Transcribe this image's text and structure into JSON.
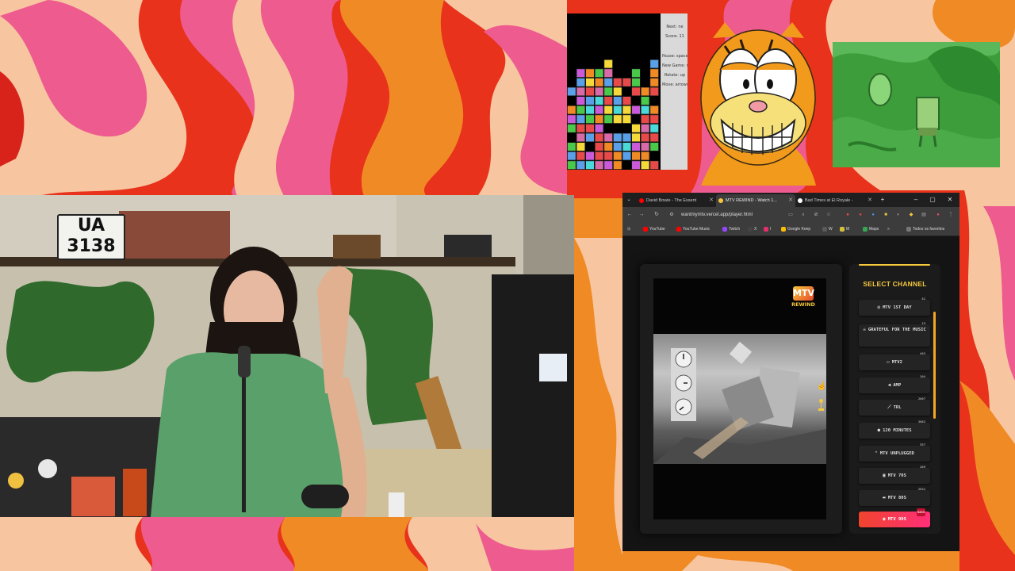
{
  "webcam": {
    "plate": [
      "UA",
      "3138"
    ]
  },
  "tetris": {
    "panel": [
      "Next: ne",
      "Score: 11",
      "Pause: space",
      "New Game: return",
      "Rotate: up",
      "Move: arrows"
    ]
  },
  "browser": {
    "tabs": [
      {
        "label": "David Bowie - The Essent",
        "color": "#ff0000",
        "active": false
      },
      {
        "label": "MTV REWIND - Watch 1...",
        "color": "#f5c73c",
        "active": true
      },
      {
        "label": "Bad Times at El Royale -",
        "color": "#ffffff",
        "active": false
      }
    ],
    "new_tab": "+",
    "window_controls": [
      "–",
      "▢",
      "✕"
    ],
    "nav": {
      "back": "←",
      "forward": "→",
      "reload": "↻"
    },
    "url": "wantmymtv.vercel.app/player.html",
    "bookmarks": [
      {
        "label": "YouTube",
        "color": "#ff0000"
      },
      {
        "label": "YouTube Music",
        "color": "#ff0000"
      },
      {
        "label": "Twitch",
        "color": "#9146ff"
      },
      {
        "label": "X",
        "color": "#444444"
      },
      {
        "label": "I",
        "color": "#e1306c"
      },
      {
        "label": "Google Keep",
        "color": "#fbbc04"
      },
      {
        "label": "W",
        "color": "#5a5a5a"
      },
      {
        "label": "M",
        "color": "#d4c13a"
      },
      {
        "label": "Maps",
        "color": "#34a853"
      },
      {
        "label": "»",
        "color": "#3c3c3c"
      },
      {
        "label": "Todos os favoritos",
        "color": "#777777"
      }
    ]
  },
  "player": {
    "logo_top": "MTV",
    "logo_bottom": "REWIND",
    "channel_title": "SELECT CHANNEL",
    "channels": [
      {
        "icon": "◎",
        "label": "MTV 1ST DAY",
        "num": "81",
        "active": false
      },
      {
        "icon": "☠",
        "label": "GRATEFUL FOR THE MUSIC",
        "num": "15",
        "active": false
      },
      {
        "icon": "▭",
        "label": "MTV2",
        "num": "403",
        "active": false
      },
      {
        "icon": "◀",
        "label": "AMP",
        "num": "104",
        "active": false
      },
      {
        "icon": "⟋",
        "label": "TRL",
        "num": "2007",
        "active": false
      },
      {
        "icon": "●",
        "label": "120 MINUTES",
        "num": "3062",
        "active": false
      },
      {
        "icon": "⌃",
        "label": "MTV UNPLUGGED",
        "num": "557",
        "active": false
      },
      {
        "icon": "▣",
        "label": "MTV 70S",
        "num": "269",
        "active": false
      },
      {
        "icon": "▬",
        "label": "MTV 80S",
        "num": "2831",
        "active": false
      },
      {
        "icon": "◉",
        "label": "MTV 90S",
        "num": "5233",
        "active": true
      }
    ]
  },
  "colors": {
    "accent": "#f5c73c",
    "active_start": "#f0442d",
    "active_end": "#ff2f7a"
  }
}
